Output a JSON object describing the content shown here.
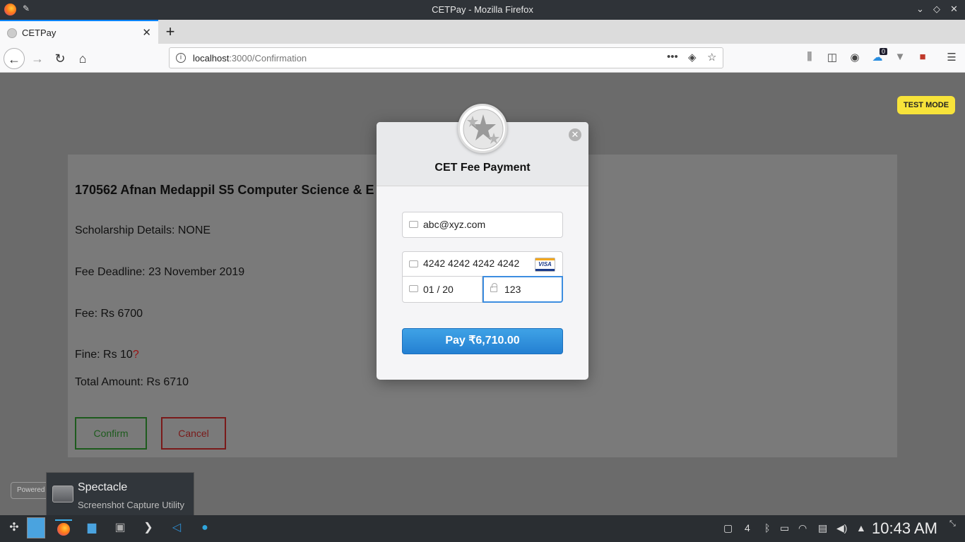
{
  "window": {
    "title": "CETPay - Mozilla Firefox"
  },
  "tabs": [
    {
      "label": "CETPay"
    }
  ],
  "urlbar": {
    "host": "localhost",
    "path": ":3000/Confirmation"
  },
  "toolbar": {
    "badge_count": "0"
  },
  "page": {
    "heading": "170562 Afnan Medappil S5 Computer Science & E",
    "scholarship": "Scholarship Details: NONE",
    "deadline": "Fee Deadline: 23 November 2019",
    "fee": "Fee: Rs 6700",
    "fine": "Fine: Rs 10",
    "fine_q": "?",
    "total": "Total Amount: Rs 6710",
    "confirm_label": "Confirm",
    "cancel_label": "Cancel",
    "test_mode": "TEST MODE",
    "powered": "Powered"
  },
  "modal": {
    "title": "CET Fee Payment",
    "email": "abc@xyz.com",
    "card_number": "4242 4242 4242 4242",
    "card_brand": "VISA",
    "expiry": "01 / 20",
    "cvc": "123",
    "pay_label": "Pay ₹6,710.00"
  },
  "tooltip": {
    "app_name": "Spectacle",
    "app_desc": "Screenshot Capture Utility"
  },
  "taskbar": {
    "clock": "10:43 AM",
    "desktop_num": "4"
  }
}
